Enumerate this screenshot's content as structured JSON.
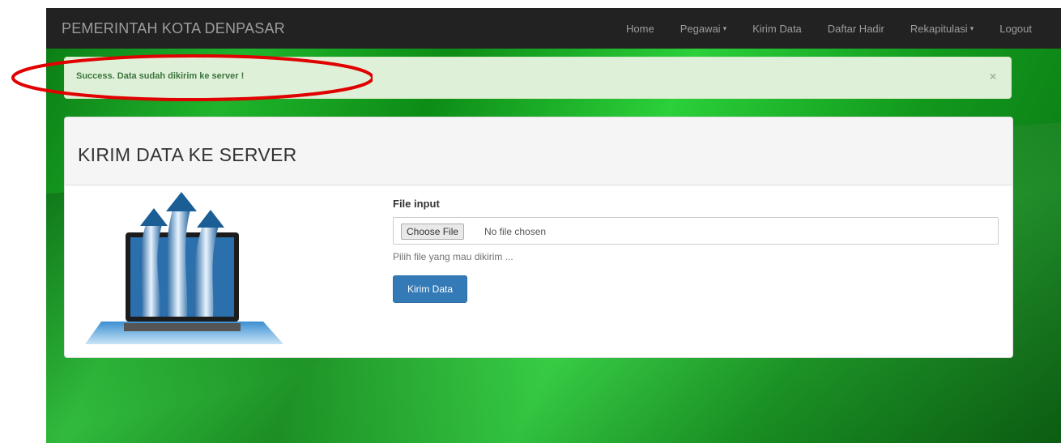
{
  "navbar": {
    "brand": "PEMERINTAH KOTA DENPASAR",
    "items": [
      {
        "label": "Home",
        "dropdown": false
      },
      {
        "label": "Pegawai",
        "dropdown": true
      },
      {
        "label": "Kirim Data",
        "dropdown": false
      },
      {
        "label": "Daftar Hadir",
        "dropdown": false
      },
      {
        "label": "Rekapitulasi",
        "dropdown": true
      },
      {
        "label": "Logout",
        "dropdown": false
      }
    ],
    "caret": "▾"
  },
  "alert": {
    "message": "Success. Data sudah dikirim ke server !",
    "close": "×",
    "color": "#3c763d",
    "background": "#dff0d8"
  },
  "panel": {
    "title": "KIRIM DATA KE SERVER",
    "illustration": "laptop-upload-arrows-image"
  },
  "form": {
    "label": "File input",
    "choose_button": "Choose File",
    "no_file": "No file chosen",
    "help": "Pilih file yang mau dikirim ...",
    "submit": "Kirim Data"
  },
  "colors": {
    "navbar": "#222222",
    "primary": "#337ab7",
    "annotation": "#e00000"
  }
}
